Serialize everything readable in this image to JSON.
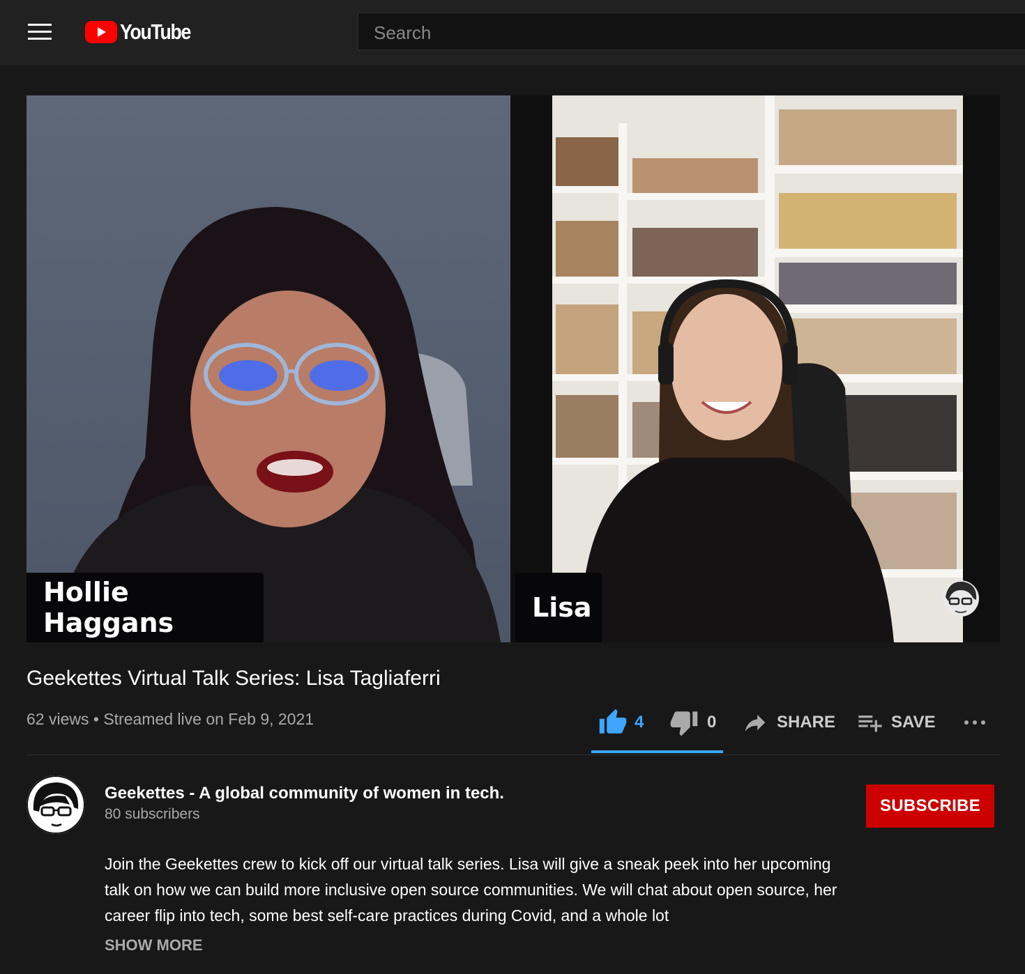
{
  "header": {
    "logo_text": "YouTube",
    "search_placeholder": "Search"
  },
  "video": {
    "participants": [
      {
        "name": "Hollie Haggans"
      },
      {
        "name": "Lisa"
      }
    ],
    "title": "Geekettes Virtual Talk Series: Lisa Tagliaferri",
    "meta": "62 views • Streamed live on Feb 9, 2021",
    "likes": "4",
    "dislikes": "0",
    "share_label": "SHARE",
    "save_label": "SAVE",
    "like_ratio": 1.0
  },
  "channel": {
    "name": "Geekettes - A global community of women in tech.",
    "subscribers": "80 subscribers",
    "subscribe_label": "SUBSCRIBE"
  },
  "description": {
    "text": "Join the Geekettes crew to kick off our virtual talk series. Lisa will give a sneak peek into her upcoming talk on how we can build more inclusive open source communities. We will chat about open source, her career flip into tech, some best self-care practices during Covid, and a whole lot",
    "show_more_label": "SHOW MORE"
  },
  "colors": {
    "accent": "#3ea6ff",
    "subscribe": "#cc0000",
    "brand_red": "#ff0000",
    "background": "#181818"
  },
  "icons": [
    "menu-icon",
    "youtube-logo-icon",
    "thumb-up-icon",
    "thumb-down-icon",
    "share-arrow-icon",
    "playlist-add-icon",
    "more-horizontal-icon"
  ]
}
